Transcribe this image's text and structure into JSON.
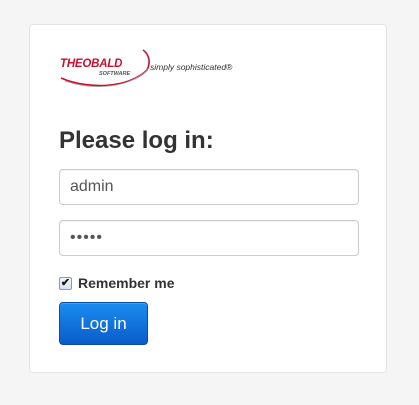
{
  "logo": {
    "brand": "THEOBALD",
    "sub": "SOFTWARE",
    "tagline": "simply sophisticated®",
    "brand_color": "#c8102e"
  },
  "form": {
    "heading": "Please log in:",
    "username_value": "admin",
    "password_value": "admin",
    "remember_label": "Remember me",
    "remember_checked": true,
    "login_label": "Log in"
  },
  "colors": {
    "background": "#f5f5f5",
    "card": "#ffffff",
    "button": "#0a5cc9",
    "heading": "#333333"
  },
  "icons": {
    "checkbox_mark": "checkmark-icon"
  }
}
